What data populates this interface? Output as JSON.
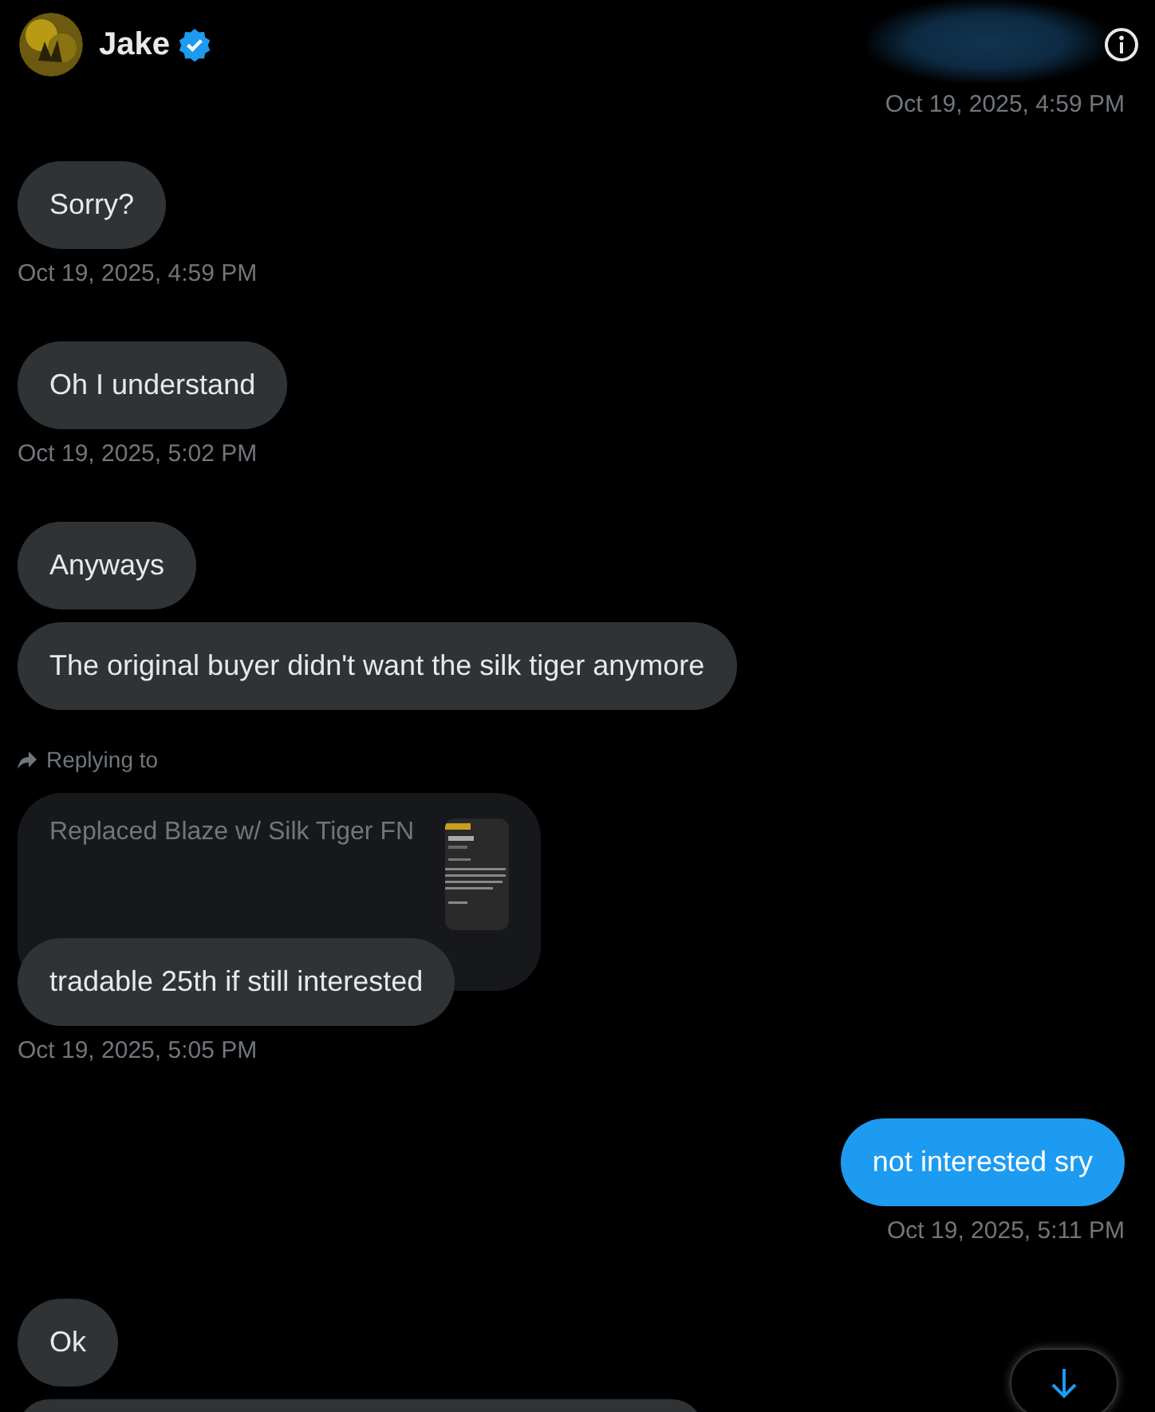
{
  "header": {
    "name": "Jake",
    "verified": true
  },
  "messages": [
    {
      "kind": "time",
      "outgoing": true,
      "text": "Oct 19, 2025, 4:59 PM"
    },
    {
      "kind": "bubble",
      "outgoing": false,
      "text": "Sorry?"
    },
    {
      "kind": "time",
      "outgoing": false,
      "text": "Oct 19, 2025, 4:59 PM"
    },
    {
      "kind": "bubble",
      "outgoing": false,
      "text": "Oh I understand"
    },
    {
      "kind": "time",
      "outgoing": false,
      "text": "Oct 19, 2025, 5:02 PM"
    },
    {
      "kind": "bubble",
      "outgoing": false,
      "text": "Anyways"
    },
    {
      "kind": "bubble",
      "outgoing": false,
      "text": "The original buyer didn't want the silk tiger anymore"
    },
    {
      "kind": "reply",
      "outgoing": false,
      "label": "Replying to",
      "quoted": "Replaced Blaze w/ Silk Tiger FN",
      "text": "tradable 25th if still interested"
    },
    {
      "kind": "time",
      "outgoing": false,
      "text": "Oct 19, 2025, 5:05 PM"
    },
    {
      "kind": "bubble",
      "outgoing": true,
      "text": "not interested sry"
    },
    {
      "kind": "time",
      "outgoing": true,
      "text": "Oct 19, 2025, 5:11 PM"
    },
    {
      "kind": "bubble",
      "outgoing": false,
      "text": "Ok"
    },
    {
      "kind": "partial",
      "outgoing": false
    }
  ]
}
